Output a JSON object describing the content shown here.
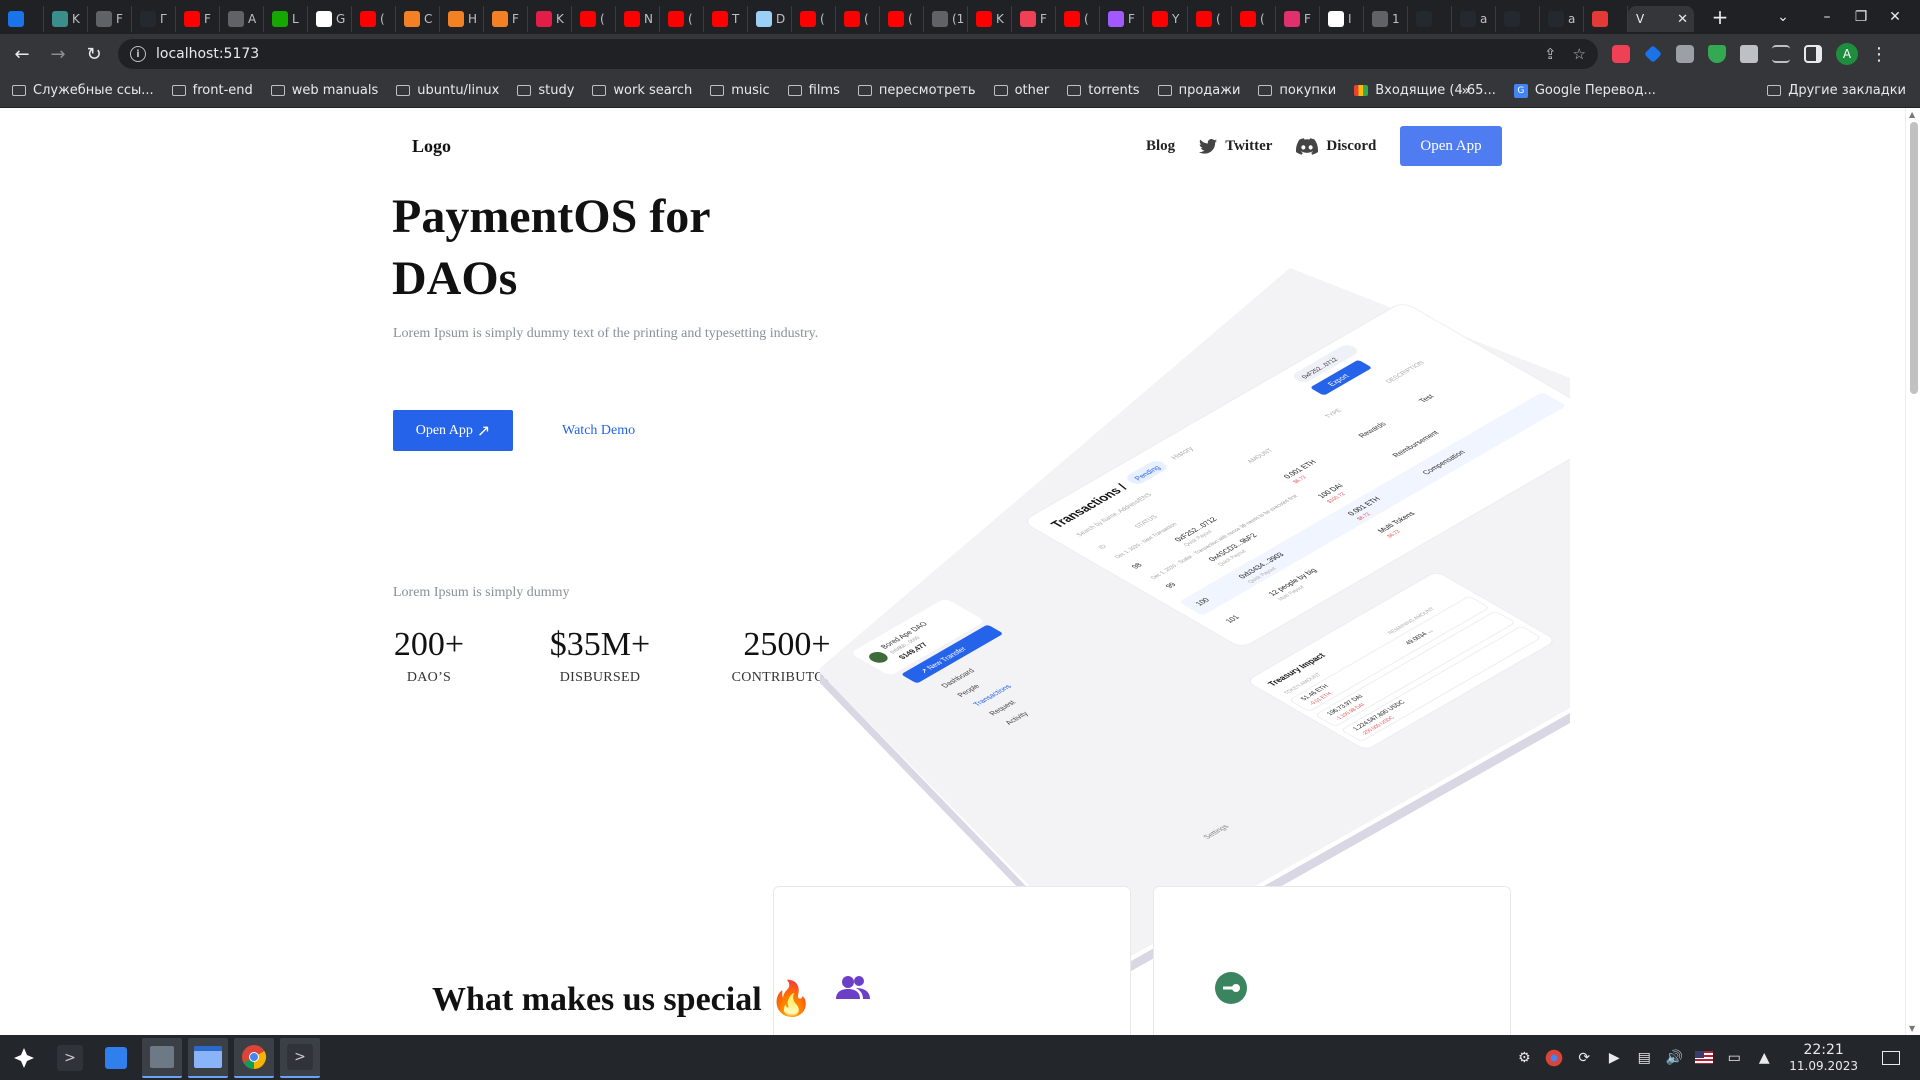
{
  "browser": {
    "tabs": [
      {
        "label": "",
        "color": "#1a73e8"
      },
      {
        "label": "K",
        "color": "#3a8e8c"
      },
      {
        "label": "F",
        "color": "#5f6368"
      },
      {
        "label": "Г",
        "color": "#24292f"
      },
      {
        "label": "F",
        "color": "#ff0000"
      },
      {
        "label": "A",
        "color": "#5f6368"
      },
      {
        "label": "L",
        "color": "#14a800"
      },
      {
        "label": "G",
        "color": "#ffffff"
      },
      {
        "label": "(",
        "color": "#ff0000"
      },
      {
        "label": "C",
        "color": "#f48024"
      },
      {
        "label": "H",
        "color": "#f48024"
      },
      {
        "label": "F",
        "color": "#f48024"
      },
      {
        "label": "K",
        "color": "#e11d48"
      },
      {
        "label": "(",
        "color": "#ff0000"
      },
      {
        "label": "N",
        "color": "#ff0000"
      },
      {
        "label": "(",
        "color": "#ff0000"
      },
      {
        "label": "T",
        "color": "#ff0000"
      },
      {
        "label": "D",
        "color": "#9ad0f5"
      },
      {
        "label": "(",
        "color": "#ff0000"
      },
      {
        "label": "(",
        "color": "#ff0000"
      },
      {
        "label": "(",
        "color": "#ff0000"
      },
      {
        "label": "(1",
        "color": "#5f6368"
      },
      {
        "label": "K",
        "color": "#ff0000"
      },
      {
        "label": "F",
        "color": "#ef4056"
      },
      {
        "label": "(",
        "color": "#ff0000"
      },
      {
        "label": "F",
        "color": "#a259ff"
      },
      {
        "label": "Y",
        "color": "#ff0000"
      },
      {
        "label": "(",
        "color": "#ff0000"
      },
      {
        "label": "(",
        "color": "#ff0000"
      },
      {
        "label": "F",
        "color": "#e1306c"
      },
      {
        "label": "I",
        "color": "#ffffff"
      },
      {
        "label": "1",
        "color": "#5f6368"
      },
      {
        "label": "",
        "color": "#24292f"
      },
      {
        "label": "a",
        "color": "#24292f"
      },
      {
        "label": "",
        "color": "#24292f"
      },
      {
        "label": "a",
        "color": "#24292f"
      },
      {
        "label": "",
        "color": "#e53935"
      }
    ],
    "active_tab": {
      "label": "V",
      "close": "✕"
    },
    "new_tab": "+",
    "window_controls": {
      "tabsearch": "⌄",
      "minimize": "–",
      "restore": "❐",
      "close": "✕"
    },
    "nav": {
      "back": "←",
      "forward": "→",
      "reload": "↻"
    },
    "url": "localhost:5173",
    "url_info": "i",
    "omnibox_icons": {
      "share": "⇪",
      "star": "☆"
    },
    "profile": "A",
    "bookmarks": [
      "Служебные ссы...",
      "front-end",
      "web manuals",
      "ubuntu/linux",
      "study",
      "work search",
      "music",
      "films",
      "пересмотреть",
      "other",
      "torrents",
      "продажи",
      "покупки"
    ],
    "bookmark_gmail": "Входящие (4 65...",
    "bookmark_translate": "Google Перевод...",
    "bookmarks_more": "»",
    "other_bookmarks": "Другие закладки"
  },
  "page": {
    "logo": "Logo",
    "nav": {
      "blog": "Blog",
      "twitter": "Twitter",
      "discord": "Discord",
      "open_app": "Open App"
    },
    "hero": {
      "title": "PaymentOS for DAOs",
      "subtitle": "Lorem Ipsum is simply dummy text of the printing and typesetting industry.",
      "open_app": "Open App",
      "open_app_arrow": "↗",
      "watch_demo": "Watch Demo"
    },
    "stats": {
      "caption": "Lorem Ipsum is simply dummy",
      "items": [
        {
          "value": "200+",
          "label": "DAO’S"
        },
        {
          "value": "$35M+",
          "label": "DISBURSED"
        },
        {
          "value": "2500+",
          "label": "CONTRIBUTORS"
        }
      ]
    },
    "preview": {
      "sidebar": {
        "dao_name": "Bored Ape DAO",
        "dao_address": "0xb8bb...0b00",
        "balance": "$149,477",
        "new_transfer": "↗ New Transfer",
        "items": [
          "Dashboard",
          "People",
          "Transactions",
          "Request",
          "Activity"
        ],
        "settings": "Settings"
      },
      "header": {
        "title": "Transactions /",
        "tab_pending": "Pending",
        "tab_history": "History",
        "wallet": "0xF252...0712",
        "export": "Export",
        "search": "Search by Name, Address/ENS"
      },
      "columns": [
        "ID",
        "STATUS",
        "AMOUNT",
        "TYPE",
        "DESCRIPTION"
      ],
      "rows": [
        {
          "id": "98",
          "to": "0xF252...0712",
          "sub": "Quick Payout",
          "amount": "0.001 ETH",
          "usd": "$6.72",
          "type": "Rewards",
          "desc": "Test"
        },
        {
          "id": "99",
          "to": "0x4SCD3...9bF2",
          "sub": "Quick Payout",
          "amount": "100 DAI",
          "usd": "$100.72",
          "type": "Reimbursement",
          "desc": ""
        },
        {
          "id": "100",
          "to": "0xb3434...3903",
          "sub": "Quick Payout",
          "amount": "0.001 ETH",
          "usd": "$6.72",
          "type": "Compensation",
          "desc": ""
        },
        {
          "id": "101",
          "to": "12 people by big",
          "sub": "Multi Payout",
          "amount": "Multi Tokens",
          "usd": "$6.72",
          "type": "",
          "desc": ""
        }
      ],
      "row_dates": [
        "Dec 1, 2020 · Next Transaction",
        "Dec 1, 2020 · Scalar · Transaction with nonce 98 needs to be executed first"
      ],
      "treasury": {
        "title": "Treasury Impact",
        "col_token": "TOKEN AMOUNT",
        "col_remaining": "REMAINING AMOUNT",
        "rows": [
          {
            "amount": "51.46 ETH",
            "sub": "-0.01 ETH",
            "remaining": "49.0034 ..."
          },
          {
            "amount": "196,73.97 DAI",
            "sub": "-1,100.98 DAI",
            "remaining": ""
          },
          {
            "amount": "1,224,567,890 USDC",
            "sub": "-200,000 USDC",
            "remaining": ""
          }
        ]
      }
    },
    "special": {
      "title": "What makes us special",
      "emoji": "🔥"
    }
  },
  "taskbar": {
    "clock_time": "22:21",
    "clock_date": "11.09.2023"
  }
}
